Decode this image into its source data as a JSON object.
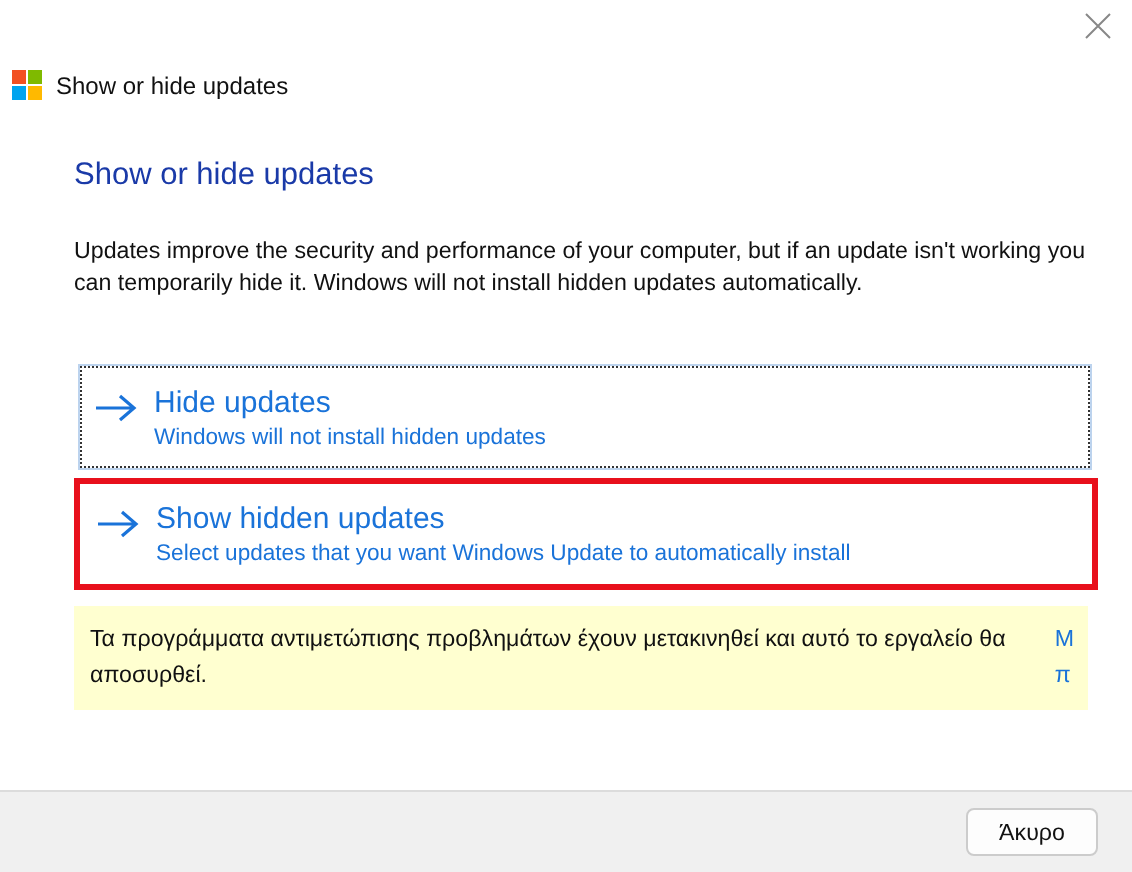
{
  "window": {
    "title": "Show or hide updates"
  },
  "heading": "Show or hide updates",
  "description": "Updates improve the security and performance of your computer, but if an update isn't working you can temporarily hide it. Windows will not install hidden updates automatically.",
  "options": [
    {
      "title": "Hide updates",
      "subtitle": "Windows will not install hidden updates",
      "focused": true,
      "highlighted": false
    },
    {
      "title": "Show hidden updates",
      "subtitle": "Select updates that you want Windows Update to automatically install",
      "focused": false,
      "highlighted": true
    }
  ],
  "notice": {
    "text": "Τα προγράμματα αντιμετώπισης προβλημάτων έχουν μετακινηθεί και αυτό το εργαλείο θα αποσυρθεί.",
    "link_lines": [
      "Μ",
      "π"
    ]
  },
  "buttons": [
    "Άκυρο"
  ]
}
